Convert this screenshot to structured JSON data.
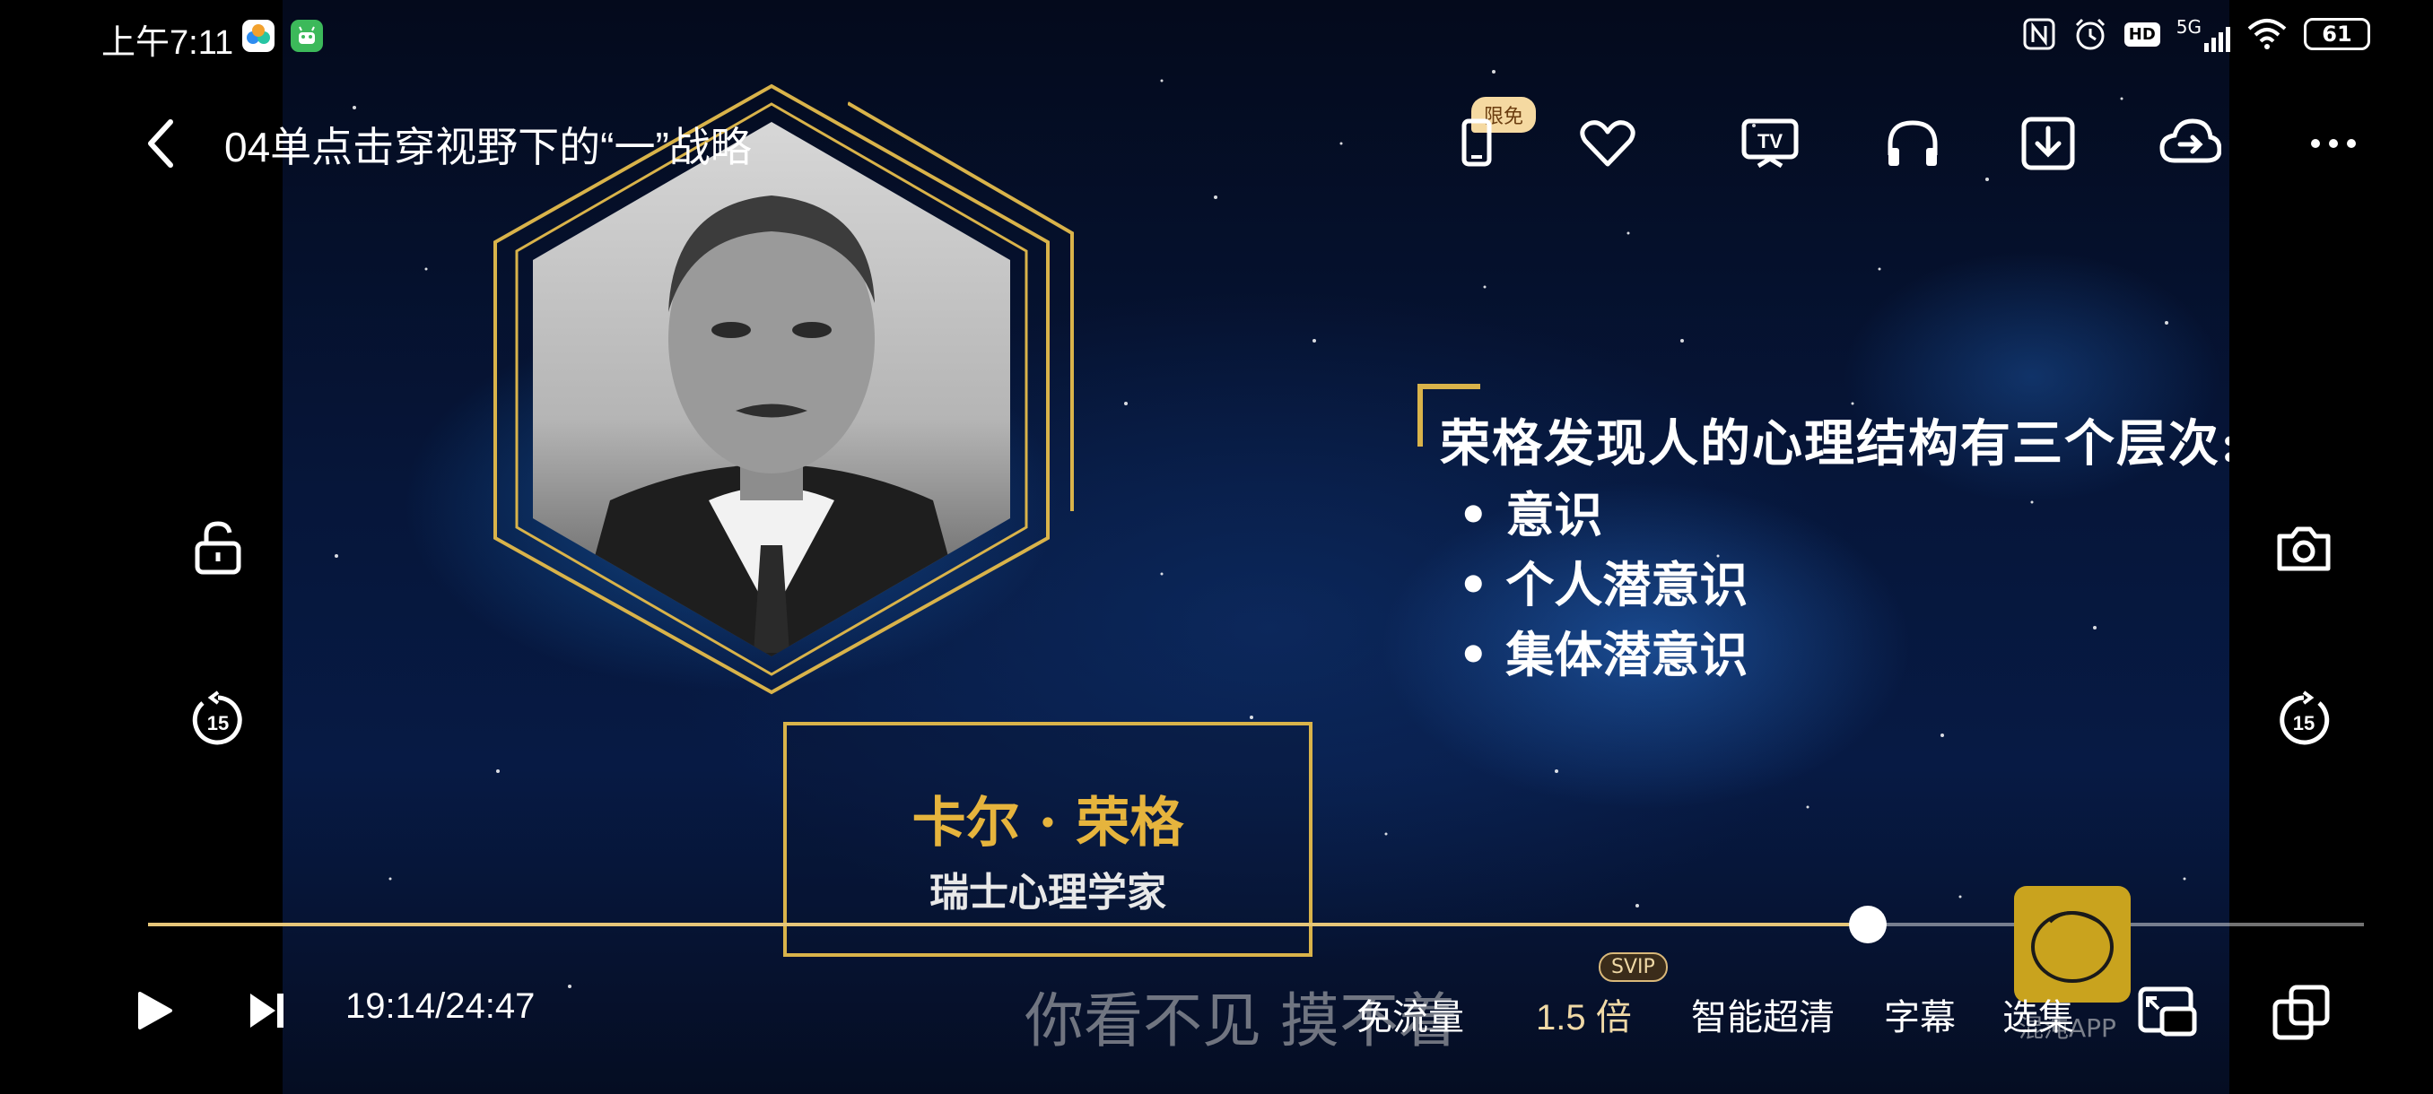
{
  "status_bar": {
    "time": "上午7:11",
    "network": "5G",
    "hd_label": "HD",
    "battery": "61"
  },
  "header": {
    "title": "04单点击穿视野下的“一”战略",
    "free_badge": "限免",
    "icons": [
      "phone-icon",
      "heart-icon",
      "tv-cast-icon",
      "headphones-icon",
      "download-icon",
      "cloud-save-icon",
      "more-icon"
    ]
  },
  "video": {
    "slide": {
      "heading": "荣格发现人的心理结构有三个层次:",
      "items": [
        "• 意识",
        "• 个人潜意识",
        "• 集体潜意识"
      ]
    },
    "nameplate": {
      "name": "卡尔 · 荣格",
      "role": "瑞士心理学家"
    },
    "subtitle": "你看不见 摸不着",
    "watermark": "混沌APP"
  },
  "side": {
    "left": [
      "unlock-icon",
      "rewind-15-icon"
    ],
    "right": [
      "camera-icon",
      "forward-15-icon"
    ],
    "rewind_label": "15",
    "forward_label": "15"
  },
  "player": {
    "current": "19:14",
    "total": "24:47",
    "timecode": "19:14/24:47",
    "progress": 0.776,
    "controls": {
      "traffic_free": "免流量",
      "speed": "1.5 倍",
      "svip": "SVIP",
      "quality": "智能超清",
      "subtitles": "字幕",
      "episodes": "选集"
    }
  },
  "colors": {
    "accent_gold": "#d9b34a",
    "progress": "#e6c679"
  }
}
